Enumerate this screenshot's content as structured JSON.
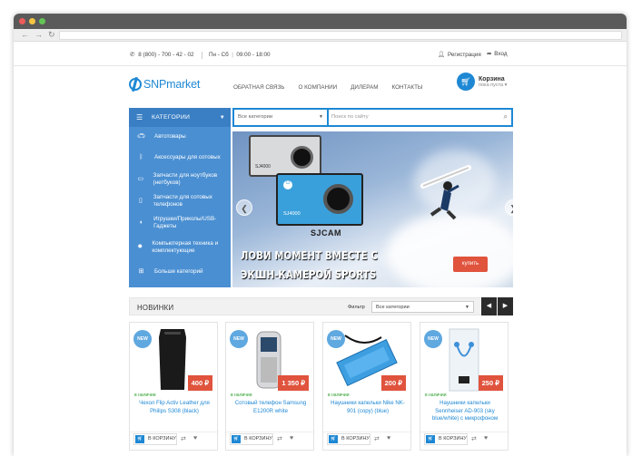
{
  "browser": {
    "colors": {
      "close": "#ee5b5b",
      "min": "#f5c542",
      "max": "#62c554"
    }
  },
  "topbar": {
    "phone": "8 (800) - 700 - 42 - 02",
    "hours_days": "Пн - Сб",
    "hours_time": "09:00 - 18:00",
    "register": "Регистрация",
    "login": "Вход"
  },
  "header": {
    "logo": "SNPmarket",
    "menu": [
      "ОБРАТНАЯ СВЯЗЬ",
      "О КОМПАНИИ",
      "ДИЛЕРАМ",
      "КОНТАКТЫ"
    ],
    "cart_title": "Корзина",
    "cart_status": "пока пуста"
  },
  "sidebar": {
    "title": "КАТЕГОРИИ",
    "items": [
      {
        "label": "Автотовары",
        "icon": "car-icon"
      },
      {
        "label": "Аксессуары для сотовых",
        "icon": "bluetooth-icon"
      },
      {
        "label": "Запчасти для ноутбуков (нетбуков)",
        "icon": "laptop-icon"
      },
      {
        "label": "Запчасти для сотовых телефонов",
        "icon": "phone-icon"
      },
      {
        "label": "Игрушки/Приколы/USB-Гаджеты",
        "icon": "pacman-icon"
      },
      {
        "label": "Компьютерная техника и комплектующие",
        "icon": "gear-icon"
      },
      {
        "label": "Больше категорий",
        "icon": "plus-icon"
      }
    ]
  },
  "search": {
    "category": "Все категории",
    "placeholder": "Поиск по сайту"
  },
  "banner": {
    "cam1_label": "SJ4000",
    "cam2_label": "SJ4000",
    "brand": "SJCAM",
    "line1": "ЛОВИ МОМЕНТ ВМЕСТЕ С",
    "line2": "ЭКШН-КАМЕРОЙ SPORTS",
    "buy": "купить"
  },
  "new_section": {
    "title": "НОВИНКИ",
    "filter_label": "Фильтр",
    "filter_value": "Все категории"
  },
  "products": [
    {
      "badge": "NEW",
      "price": "400 ₽",
      "stock": "в наличии",
      "name": "Чехол Flip Activ Leather для Philips S308 (black)",
      "cart": "В КОРЗИНУ"
    },
    {
      "badge": "NEW",
      "price": "1 350 ₽",
      "stock": "в наличии",
      "name": "Сотовый телефон Samsung E1200R white",
      "cart": "В КОРЗИНУ"
    },
    {
      "badge": "NEW",
      "price": "200 ₽",
      "stock": "в наличии",
      "name": "Наушники капельки Nike NK-901 (copy) (blue)",
      "cart": "В КОРЗИНУ"
    },
    {
      "badge": "NEW",
      "price": "250 ₽",
      "stock": "в наличии",
      "name": "Наушники капельки Sennheiser AD-903 (sky blue/white) с микрофоном",
      "cart": "В КОРЗИНУ"
    }
  ]
}
